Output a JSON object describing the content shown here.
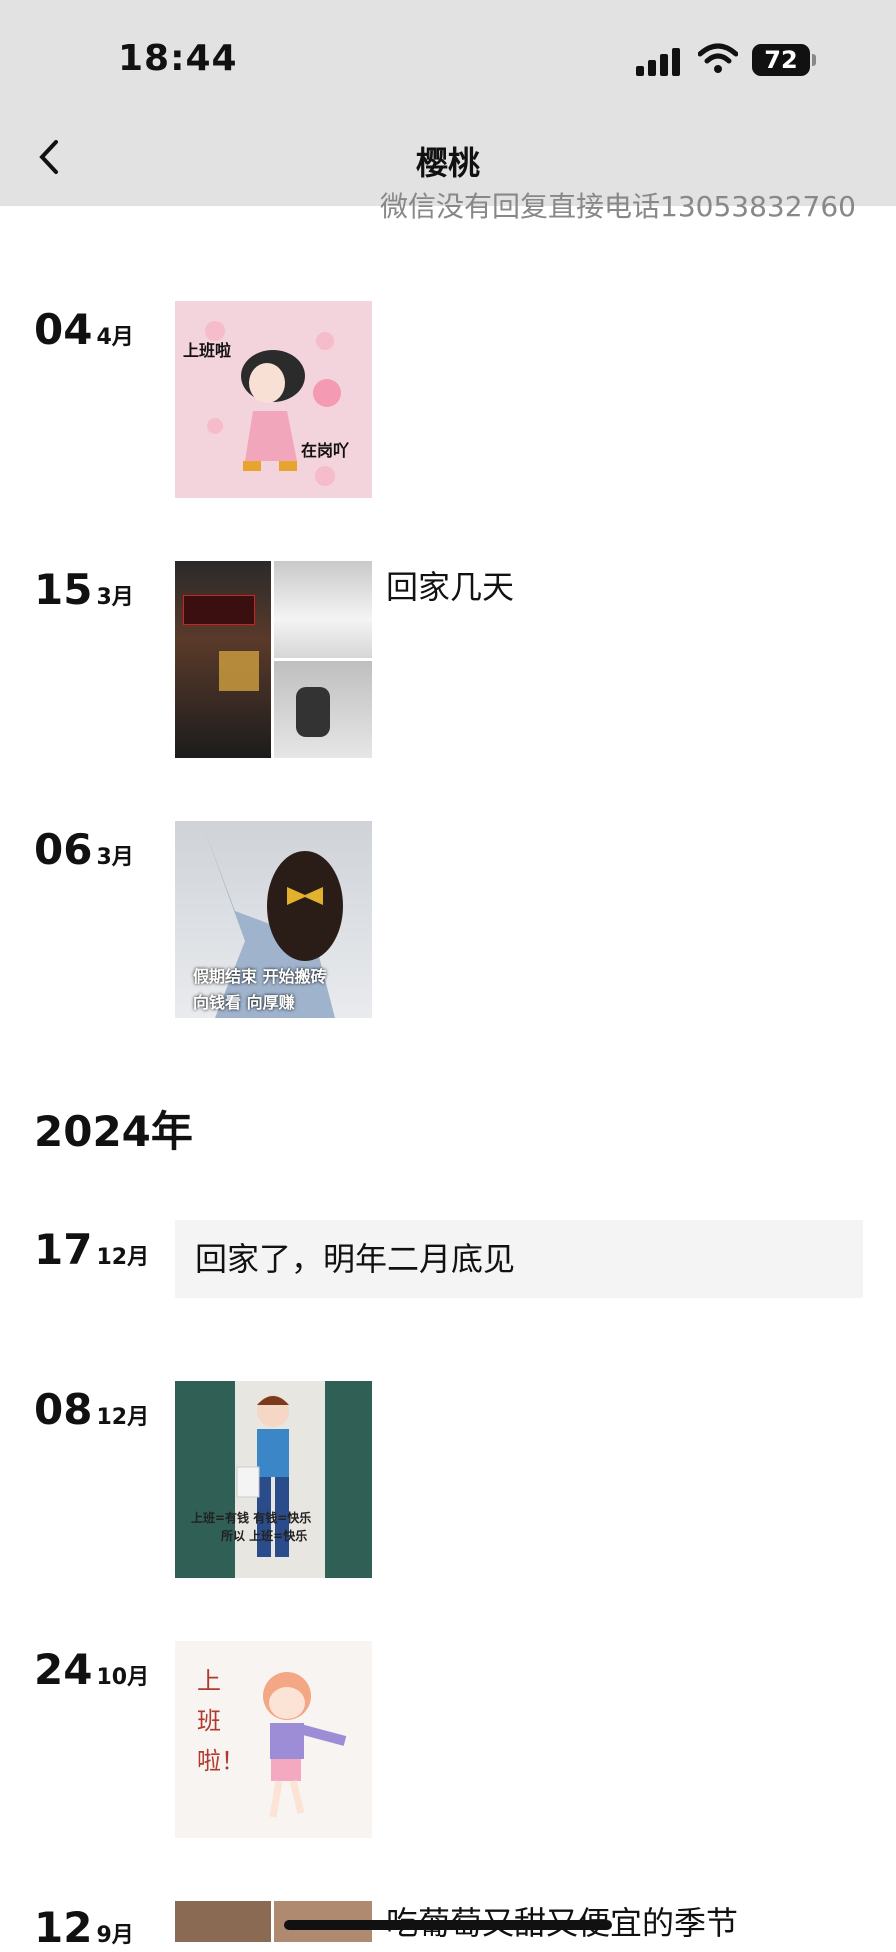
{
  "status": {
    "time": "18:44",
    "battery": "72"
  },
  "nav": {
    "title": "樱桃"
  },
  "clipped_text": "微信没有回复直接电话13053832760",
  "entries": [
    {
      "day": "04",
      "month": "4月",
      "captions": [
        "上班啦",
        "在岗吖"
      ]
    },
    {
      "day": "15",
      "month": "3月",
      "text": "回家几天"
    },
    {
      "day": "06",
      "month": "3月",
      "captions": [
        "假期结束 开始搬砖",
        "向钱看 向厚赚"
      ]
    }
  ],
  "year": "2024年",
  "entries_2024": [
    {
      "day": "17",
      "month": "12月",
      "text": "回家了，明年二月底见"
    },
    {
      "day": "08",
      "month": "12月",
      "captions": [
        "上班=有钱  有钱=快乐",
        "所以 上班=快乐"
      ]
    },
    {
      "day": "24",
      "month": "10月",
      "captions": [
        "上班啦！"
      ]
    },
    {
      "day": "12",
      "month": "9月",
      "text": "吃葡萄又甜又便宜的季节"
    }
  ],
  "colors": {
    "header_bg": "#e2e2e2",
    "card_bg": "#f4f4f4",
    "pink": "#f3d3dc"
  },
  "icons": [
    "signal-icon",
    "wifi-icon",
    "battery-icon",
    "back-chevron-icon"
  ]
}
